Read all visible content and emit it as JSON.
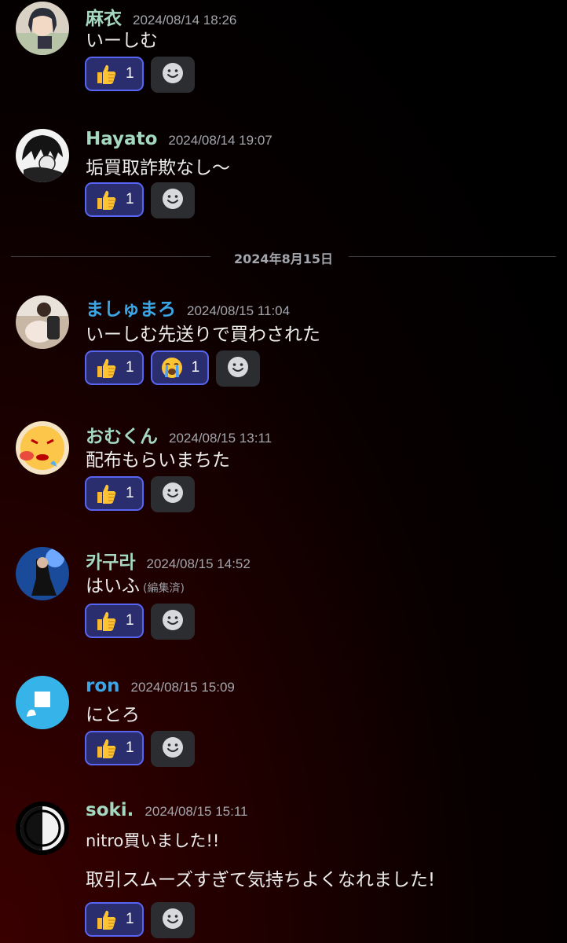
{
  "date_divider": "2024年8月15日",
  "messages": [
    {
      "author": "麻衣",
      "color": "#a4d8c0",
      "time": "2024/08/14 18:26",
      "lines": [
        "いーしむ"
      ],
      "reactions": [
        {
          "emoji": "thumbs-up",
          "count": "1"
        }
      ]
    },
    {
      "author": "Hayato",
      "color": "#a4d8c0",
      "time": "2024/08/14 19:07",
      "lines": [
        "垢買取詐欺なし〜"
      ],
      "reactions": [
        {
          "emoji": "thumbs-up",
          "count": "1"
        }
      ]
    },
    {
      "author": "ましゅまろ",
      "color": "#3ba6e6",
      "time": "2024/08/15 11:04",
      "lines": [
        "いーしむ先送りで買わされた"
      ],
      "reactions": [
        {
          "emoji": "thumbs-up",
          "count": "1"
        },
        {
          "emoji": "loudly-crying-face",
          "count": "1"
        }
      ]
    },
    {
      "author": "おむくん",
      "color": "#a4d8c0",
      "time": "2024/08/15 13:11",
      "lines": [
        "配布もらいまちた"
      ],
      "reactions": [
        {
          "emoji": "thumbs-up",
          "count": "1"
        }
      ]
    },
    {
      "author": "카구라",
      "color": "#a4d8c0",
      "time": "2024/08/15 14:52",
      "lines": [
        "はいふ"
      ],
      "edited": "(編集済)",
      "reactions": [
        {
          "emoji": "thumbs-up",
          "count": "1"
        }
      ]
    },
    {
      "author": "ron",
      "color": "#3ba6e6",
      "time": "2024/08/15 15:09",
      "lines": [
        "にとろ"
      ],
      "reactions": [
        {
          "emoji": "thumbs-up",
          "count": "1"
        }
      ]
    },
    {
      "author": "soki.",
      "color": "#a4d8c0",
      "time": "2024/08/15 15:11",
      "lines": [
        "nitro買いました!!",
        "取引スムーズすぎて気持ちよくなれました!"
      ],
      "reactions": [
        {
          "emoji": "thumbs-up",
          "count": "1"
        }
      ]
    }
  ]
}
